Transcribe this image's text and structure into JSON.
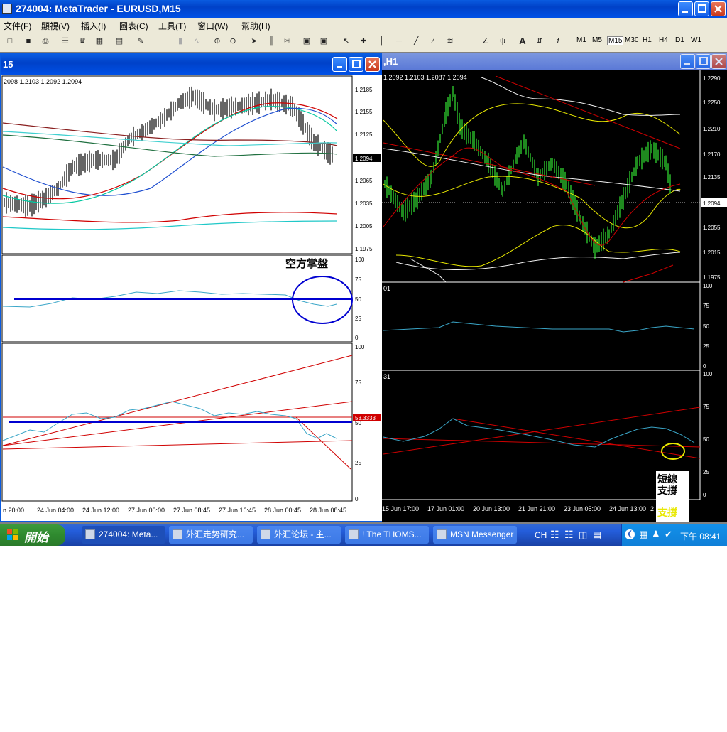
{
  "app": {
    "title": "274004: MetaTrader - EURUSD,M15"
  },
  "menu": [
    "文件(F)",
    "顯視(V)",
    "插入(I)",
    "圖表(C)",
    "工具(T)",
    "窗口(W)",
    "幫助(H)"
  ],
  "timeframes": [
    "M1",
    "M5",
    "M15",
    "M30",
    "H1",
    "H4",
    "D1",
    "W1"
  ],
  "active_timeframe": "M15",
  "chart_m15": {
    "window_title": "15",
    "ohlc": "2098 1.2103 1.2092 1.2094",
    "price_ticks": [
      "1.2185",
      "1.2155",
      "1.2125",
      "1.2094",
      "1.2065",
      "1.2035",
      "1.2005",
      "1.1975"
    ],
    "current_price": "1.2094",
    "rsi_ticks": [
      "100",
      "75",
      "50",
      "25",
      "0"
    ],
    "rsi_annotation": "空方掌盤",
    "rsi2_ticks": [
      "100",
      "75",
      "50",
      "25",
      "0"
    ],
    "rsi2_value": "53.3333",
    "time_ticks": [
      "n 20:00",
      "24 Jun 04:00",
      "24 Jun 12:00",
      "27 Jun 00:00",
      "27 Jun 08:45",
      "27 Jun 16:45",
      "28 Jun 00:45",
      "28 Jun 08:45"
    ]
  },
  "chart_h1": {
    "window_title": ",H1",
    "ohlc": "1.2092 1.2103 1.2087 1.2094",
    "price_ticks": [
      "1.2290",
      "1.2250",
      "1.2210",
      "1.2170",
      "1.2135",
      "1.2094",
      "1.2055",
      "1.2015",
      "1.1975"
    ],
    "current_price": "1.2094",
    "sub1_label": "01",
    "sub1_ticks": [
      "100",
      "75",
      "50",
      "25",
      "0"
    ],
    "sub2_label": "31",
    "sub2_ticks": [
      "100",
      "75",
      "50",
      "25",
      "0"
    ],
    "annotation_lines": [
      "短線",
      "支撐"
    ],
    "annotation_faded": "支撐",
    "time_ticks": [
      "15 Jun 17:00",
      "17 Jun 01:00",
      "20 Jun 13:00",
      "21 Jun 21:00",
      "23 Jun 05:00",
      "24 Jun 13:00",
      "2"
    ]
  },
  "taskbar": {
    "start_label": "開始",
    "tasks": [
      "274004: Meta...",
      "外汇走势研究...",
      "外汇论坛 - 主...",
      "! The THOMS...",
      "MSN Messenger"
    ],
    "lang": "CH",
    "clock": "下午 08:41"
  },
  "colors": {
    "xp_blue": "#0a5be0",
    "chart_black": "#000000",
    "candle_green": "#1f8a1f",
    "ma_red": "#d00000",
    "ma_yellow": "#e8e800",
    "rsi_cyan": "#3aa6c8",
    "level_blue": "#0000d0"
  }
}
